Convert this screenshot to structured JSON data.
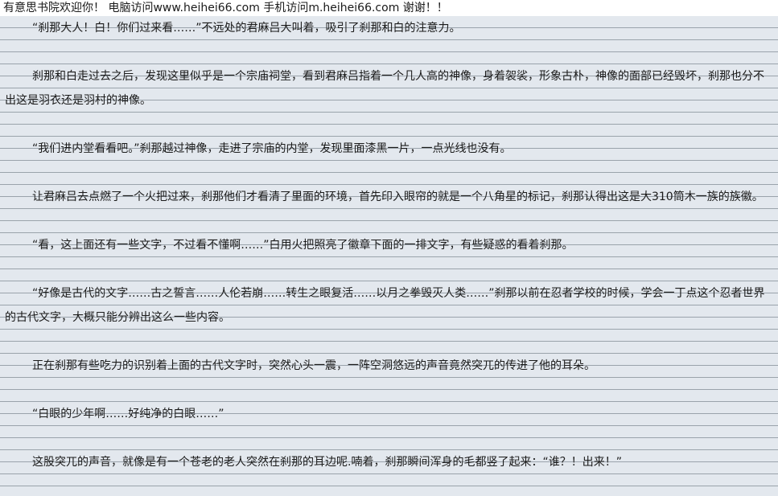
{
  "top_notice": "有意思书院欢迎你！  电脑访问www.heihei66.com    手机访问m.heihei66.com  谢谢！！",
  "paragraphs": [
    "“刹那大人！白！你们过来看……”不远处的君麻吕大叫着，吸引了刹那和白的注意力。",
    "刹那和白走过去之后，发现这里似乎是一个宗庙祠堂，看到君麻吕指着一个几人高的神像，身着袈裟，形象古朴，神像的面部已经毁坏，刹那也分不出这是羽衣还是羽村的神像。",
    "“我们进内堂看看吧。”刹那越过神像，走进了宗庙的内堂，发现里面漆黑一片，一点光线也没有。",
    "让君麻吕去点燃了一个火把过来，刹那他们才看清了里面的环境，首先印入眼帘的就是一个八角星的标记，刹那认得出这是大310筒木一族的族徽。",
    "“看，这上面还有一些文字，不过看不懂啊……”白用火把照亮了徽章下面的一排文字，有些疑惑的看着刹那。",
    "“好像是古代的文字……古之誓言……人伦若崩……转生之眼复活……以月之拳毁灭人类……”刹那以前在忍者学校的时候，学会一丁点这个忍者世界的古代文字，大概只能分辨出这么一些内容。",
    "正在刹那有些吃力的识别着上面的古代文字时，突然心头一震，一阵空洞悠远的声音竟然突兀的传进了他的耳朵。",
    "“白眼的少年啊……好纯净的白眼……”",
    "这股突兀的声音，就像是有一个苍老的老人突然在刹那的耳边呢.喃着，刹那瞬间浑身的毛都竖了起来：“谁？！出来！”"
  ]
}
